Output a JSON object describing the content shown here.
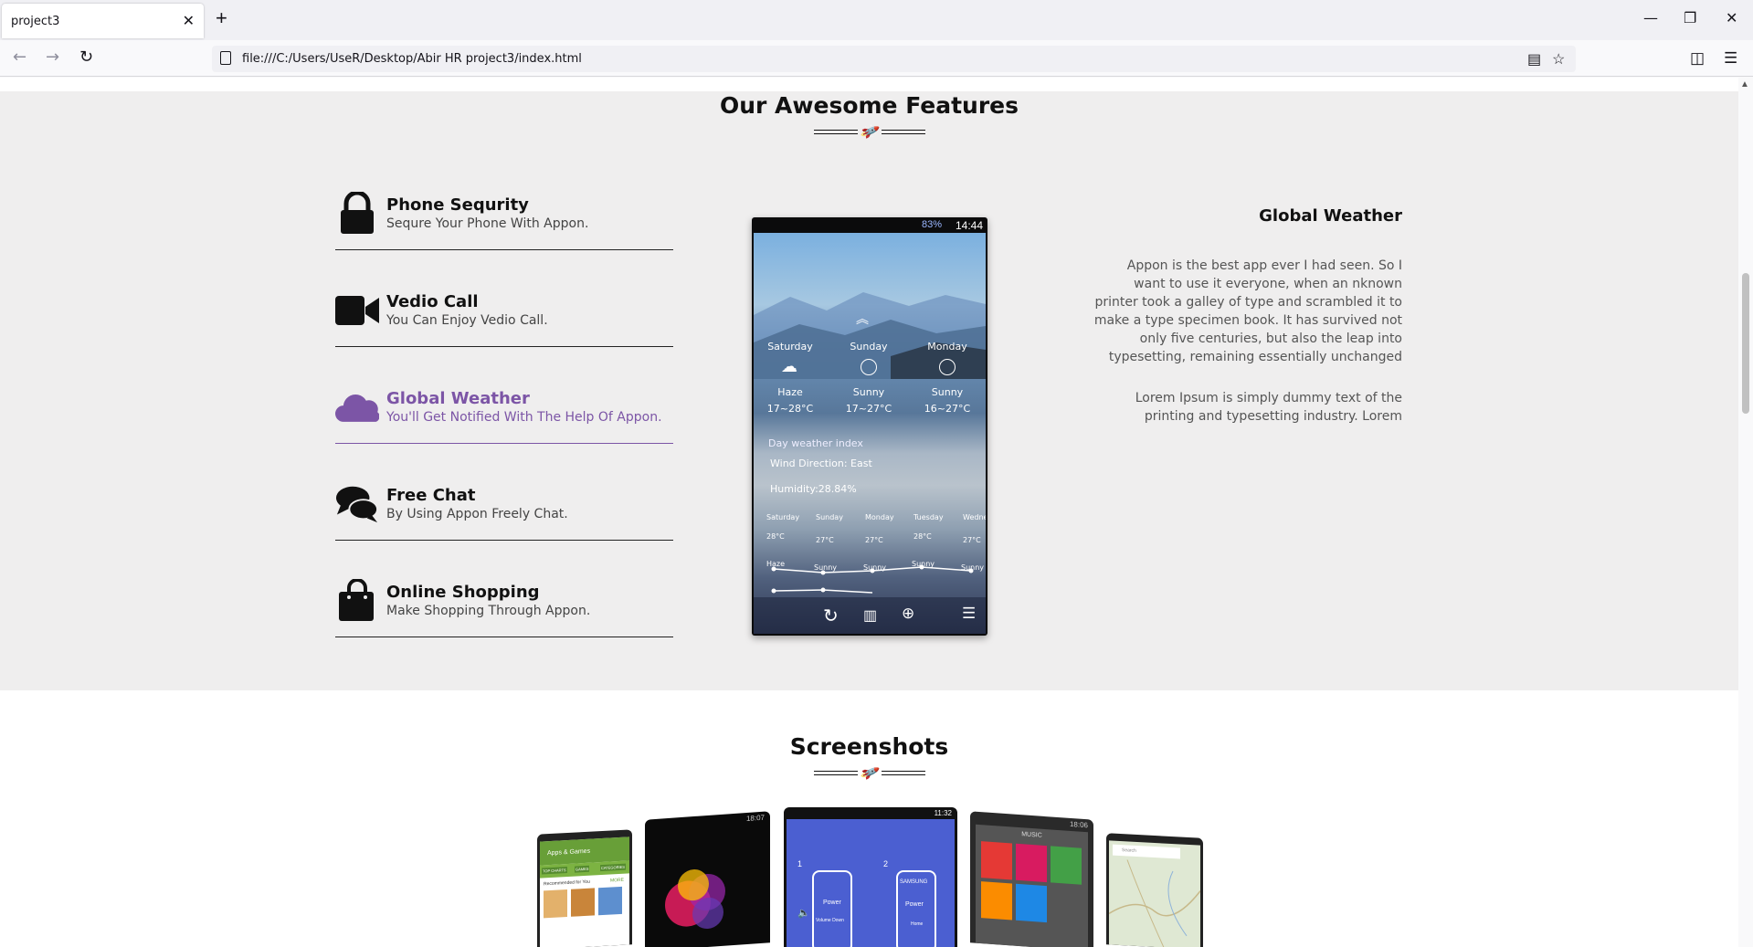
{
  "browser": {
    "tab_title": "project3",
    "url": "file:///C:/Users/UseR/Desktop/Abir HR project3/index.html"
  },
  "features_section": {
    "title": "Our Awesome Features",
    "items": [
      {
        "title": "Phone Sequrity",
        "subtitle": "Sequre Your Phone With Appon.",
        "icon": "lock-icon"
      },
      {
        "title": "Vedio Call",
        "subtitle": "You Can Enjoy Vedio Call.",
        "icon": "video-camera-icon"
      },
      {
        "title": "Global Weather",
        "subtitle": "You'll Get Notified With The Help Of Appon.",
        "icon": "cloud-icon"
      },
      {
        "title": "Free Chat",
        "subtitle": "By Using Appon Freely Chat.",
        "icon": "chat-bubbles-icon"
      },
      {
        "title": "Online Shopping",
        "subtitle": "Make Shopping Through Appon.",
        "icon": "shopping-bag-icon"
      }
    ],
    "accent_color": "#7c55a6",
    "detail": {
      "title": "Global Weather",
      "paragraph1": "Appon is the best app ever I had seen. So I want to use it everyone, when an nknown printer took a galley of type and scrambled it to make a type specimen book. It has survived not only five centuries, but also the leap into typesetting, remaining essentially unchanged",
      "paragraph2": "Lorem Ipsum is simply dummy text of the printing and typesetting industry. Lorem"
    },
    "phone": {
      "battery": "83%",
      "time": "14:44",
      "days": [
        {
          "day": "Saturday",
          "cond": "Haze",
          "temp": "17~28°C"
        },
        {
          "day": "Sunday",
          "cond": "Sunny",
          "temp": "17~27°C"
        },
        {
          "day": "Monday",
          "cond": "Sunny",
          "temp": "16~27°C"
        }
      ],
      "index_label": "Day weather index",
      "wind": "Wind Direction: East",
      "humidity": "Humidity:28.84%",
      "week": [
        "Saturday",
        "Sunday",
        "Monday",
        "Tuesday",
        "Wednes"
      ],
      "week_temps": [
        "28°C",
        "27°C",
        "27°C",
        "28°C",
        "27°C"
      ],
      "week_cond": [
        "Haze",
        "Sunny",
        "Sunny",
        "Sunny",
        "Sunny"
      ]
    }
  },
  "screenshots_section": {
    "title": "Screenshots",
    "phone1": {
      "title": "Apps & Games",
      "tabs": [
        "TOP CHARTS",
        "GAMES",
        "CATEGORIES"
      ],
      "recommended": "Recommended for You",
      "more": "MORE"
    },
    "phone2": {
      "time": "18:07"
    },
    "phone3": {
      "time": "11:32",
      "step1": "1",
      "step2": "2",
      "brand": "SAMSUNG",
      "power1": "Power",
      "power2": "Power",
      "vol": "Volume Down",
      "home": "Home"
    },
    "phone4": {
      "time": "18:06",
      "title": "MUSIC"
    },
    "phone5": {
      "search": "Search"
    }
  }
}
